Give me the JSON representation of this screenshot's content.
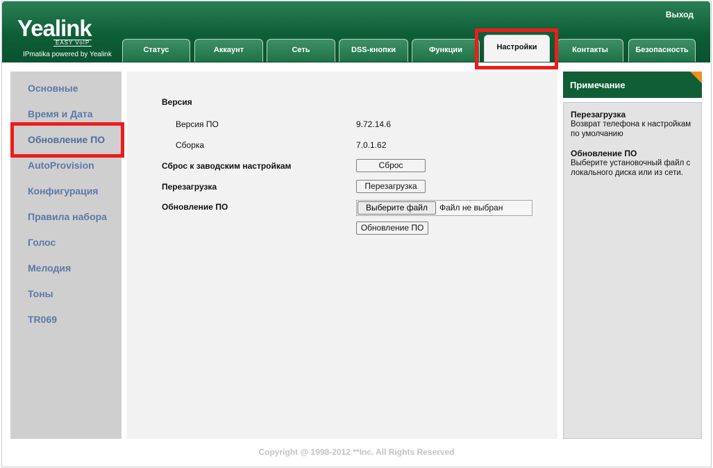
{
  "header": {
    "logo": "Yealink",
    "logo_sub": "EASY VoIP",
    "tagline": "IPmatika powered by Yealink",
    "logout": "Выход"
  },
  "tabs": [
    {
      "label": "Статус"
    },
    {
      "label": "Аккаунт"
    },
    {
      "label": "Сеть"
    },
    {
      "label": "DSS-кнопки"
    },
    {
      "label": "Функции"
    },
    {
      "label": "Настройки",
      "active": true
    },
    {
      "label": "Контакты"
    },
    {
      "label": "Безопасность"
    }
  ],
  "sidebar": {
    "items": [
      {
        "label": "Основные"
      },
      {
        "label": "Время и Дата"
      },
      {
        "label": "Обновление ПО",
        "active": true
      },
      {
        "label": "AutoProvision"
      },
      {
        "label": "Конфигурация"
      },
      {
        "label": "Правила набора"
      },
      {
        "label": "Голос"
      },
      {
        "label": "Мелодия"
      },
      {
        "label": "Тоны"
      },
      {
        "label": "TR069"
      }
    ]
  },
  "main": {
    "version_heading": "Версия",
    "firmware_label": "Версия ПО",
    "firmware_value": "9.72.14.6",
    "build_label": "Сборка",
    "build_value": "7.0.1.62",
    "reset_label": "Сброс к заводским настройкам",
    "reset_button": "Сброс",
    "reboot_label": "Перезагрузка",
    "reboot_button": "Перезагрузка",
    "upgrade_label": "Обновление ПО",
    "choose_file_button": "Выберите файл",
    "no_file_text": "Файл не выбран",
    "upgrade_button": "Обновление ПО"
  },
  "note": {
    "title": "Примечание",
    "items": [
      {
        "title": "Перезагрузка",
        "text": "Возврат телефона к настройкам по умолчанию"
      },
      {
        "title": "Обновление ПО",
        "text": "Выберите установочный файл с локального диска или из сети."
      }
    ]
  },
  "footer": "Copyright @ 1998-2012 **Inc. All Rights Reserved",
  "colors": {
    "header_green": "#0d5e36",
    "highlight_red": "#ee1c1c",
    "sidebar_link": "#5c79a8",
    "note_corner": "#ef8f1f"
  }
}
